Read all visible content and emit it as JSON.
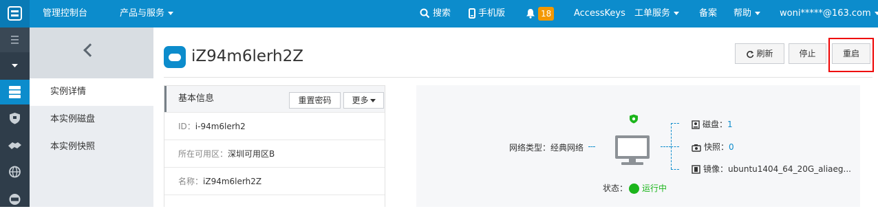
{
  "topbar": {
    "console": "管理控制台",
    "products": "产品与服务",
    "search": "搜索",
    "mobile": "手机版",
    "notify_count": "18",
    "accesskeys": "AccessKeys",
    "tickets": "工单服务",
    "record": "备案",
    "help": "帮助",
    "user": "woni*****@163.com"
  },
  "subnav": {
    "items": [
      "实例详情",
      "本实例磁盘",
      "本实例快照"
    ]
  },
  "instance": {
    "title": "iZ94m6lerh2Z"
  },
  "actions": {
    "refresh": "刷新",
    "stop": "停止",
    "restart": "重启"
  },
  "info_panel": {
    "title": "基本信息",
    "reset_password": "重置密码",
    "more": "更多",
    "rows": [
      {
        "label": "ID：",
        "value": "i-94m6lerh2"
      },
      {
        "label": "所在可用区：",
        "value": "深圳可用区B"
      },
      {
        "label": "名称：",
        "value": "iZ94m6lerh2Z"
      }
    ]
  },
  "topology": {
    "network_label": "网络类型：",
    "network_value": "经典网络",
    "disk_label": "磁盘：",
    "disk_value": "1",
    "snapshot_label": "快照：",
    "snapshot_value": "0",
    "image_label": "镜像：",
    "image_value": "ubuntu1404_64_20G_aliaeg...",
    "status_label": "状态：",
    "status_value": "运行中"
  },
  "colors": {
    "topbar": "#0c8ccc",
    "rail": "#2f3d4a",
    "badge": "#f39800",
    "running": "#1cb51c",
    "highlight": "#ee0000"
  }
}
